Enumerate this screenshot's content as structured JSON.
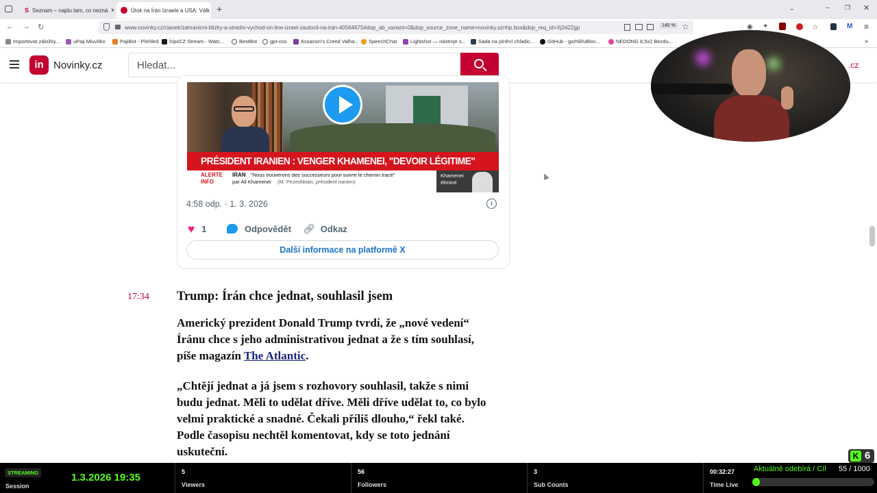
{
  "browser": {
    "tabs": [
      {
        "title": "Seznam – najdu tam, co nezná",
        "active": false
      },
      {
        "title": "Útok na Írán Izraele a USA: Válk",
        "active": true
      }
    ],
    "new_tab": "+",
    "url": "www.novinky.cz/clanek/zahranicni-blizky-a-stredni-vychod-on-line-izrael-zautocil-na-iran-40564675#dop_ab_variant=0&dop_source_zone_name=novinky.sznhp.box&dop_req_id=Xj3422gp",
    "zoom": "140 %",
    "bookmarks": [
      "Importovat záložky...",
      "uPaji Mluvítko",
      "PajiBot - Přehled",
      "ÍripxCZ Stream - Watc...",
      "BestBot",
      "gpt-oss",
      "Assassin's Creed Valha...",
      "SpeechChat",
      "Lightshot — nástroje s...",
      "Sada na plnění chladic...",
      "GitHub - gorhill/uBloc...",
      "NEDONG 8,5x2 Bezdu..."
    ]
  },
  "site": {
    "logo_mark": "in",
    "logo_text": "Novinky.cz",
    "search_placeholder": "Hledat...",
    "right_fragment": ".cz"
  },
  "tweet": {
    "video_headline": "PRÉSIDENT IRANIEN : VENGER KHAMENEI, \"DEVOIR LÉGITIME\"",
    "ticker_label_1": "ALERTE",
    "ticker_label_2": "INFO",
    "ticker_topic": "IRAN",
    "ticker_quote": "\"Nous trouverons des successeurs pour suivre le chemin tracé\"",
    "ticker_quote_2": "par Ali Khamenei",
    "ticker_attrib": "(M. Pezeshkian, président iranien)",
    "inset_label_1": "Khamenei",
    "inset_label_2": "éliminé",
    "timestamp": "4:58 odp. · 1. 3. 2026",
    "like_count": "1",
    "reply_label": "Odpovědět",
    "link_label": "Odkaz",
    "more_label": "Další informace na platformě X"
  },
  "entry": {
    "time": "17:34",
    "headline": "Trump: Írán chce jednat, souhlasil jsem",
    "para1_line1": "Americký prezident Donald Trump tvrdí, že „nové vedení“",
    "para1_line2": "Íránu chce s jeho administrativou jednat a že s tím souhlasí,",
    "para1_line3_pre": "píše magazín ",
    "para1_link": "The Atlantic",
    "para1_line3_post": ".",
    "para2_lines": [
      "„Chtějí jednat a já jsem s rozhovory souhlasil, takže s nimi",
      "budu jednat. Měli to udělat dříve. Měli dříve udělat to, co bylo",
      "velmi praktické a snadné. Čekali příliš dlouho,“ řekl také.",
      "Podle časopisu nechtěl komentovat, kdy se toto jednání",
      "uskuteční."
    ]
  },
  "stream": {
    "status": "STREAMING",
    "session_label": "Session",
    "datetime": "1.3.2026 19:35",
    "viewers_value": "5",
    "viewers_label": "Viewers",
    "followers_value": "56",
    "followers_label": "Followers",
    "subs_value": "3",
    "subs_label": "Sub Counts",
    "time_live_value": "00:32:27",
    "time_live_label": "Time Live",
    "goal_label": "Aktuálně odebírá / Cíl",
    "goal_value": "55 / 1000",
    "goal_progress": 0.055,
    "kick_badge": "6",
    "accent": "#53fc18"
  }
}
